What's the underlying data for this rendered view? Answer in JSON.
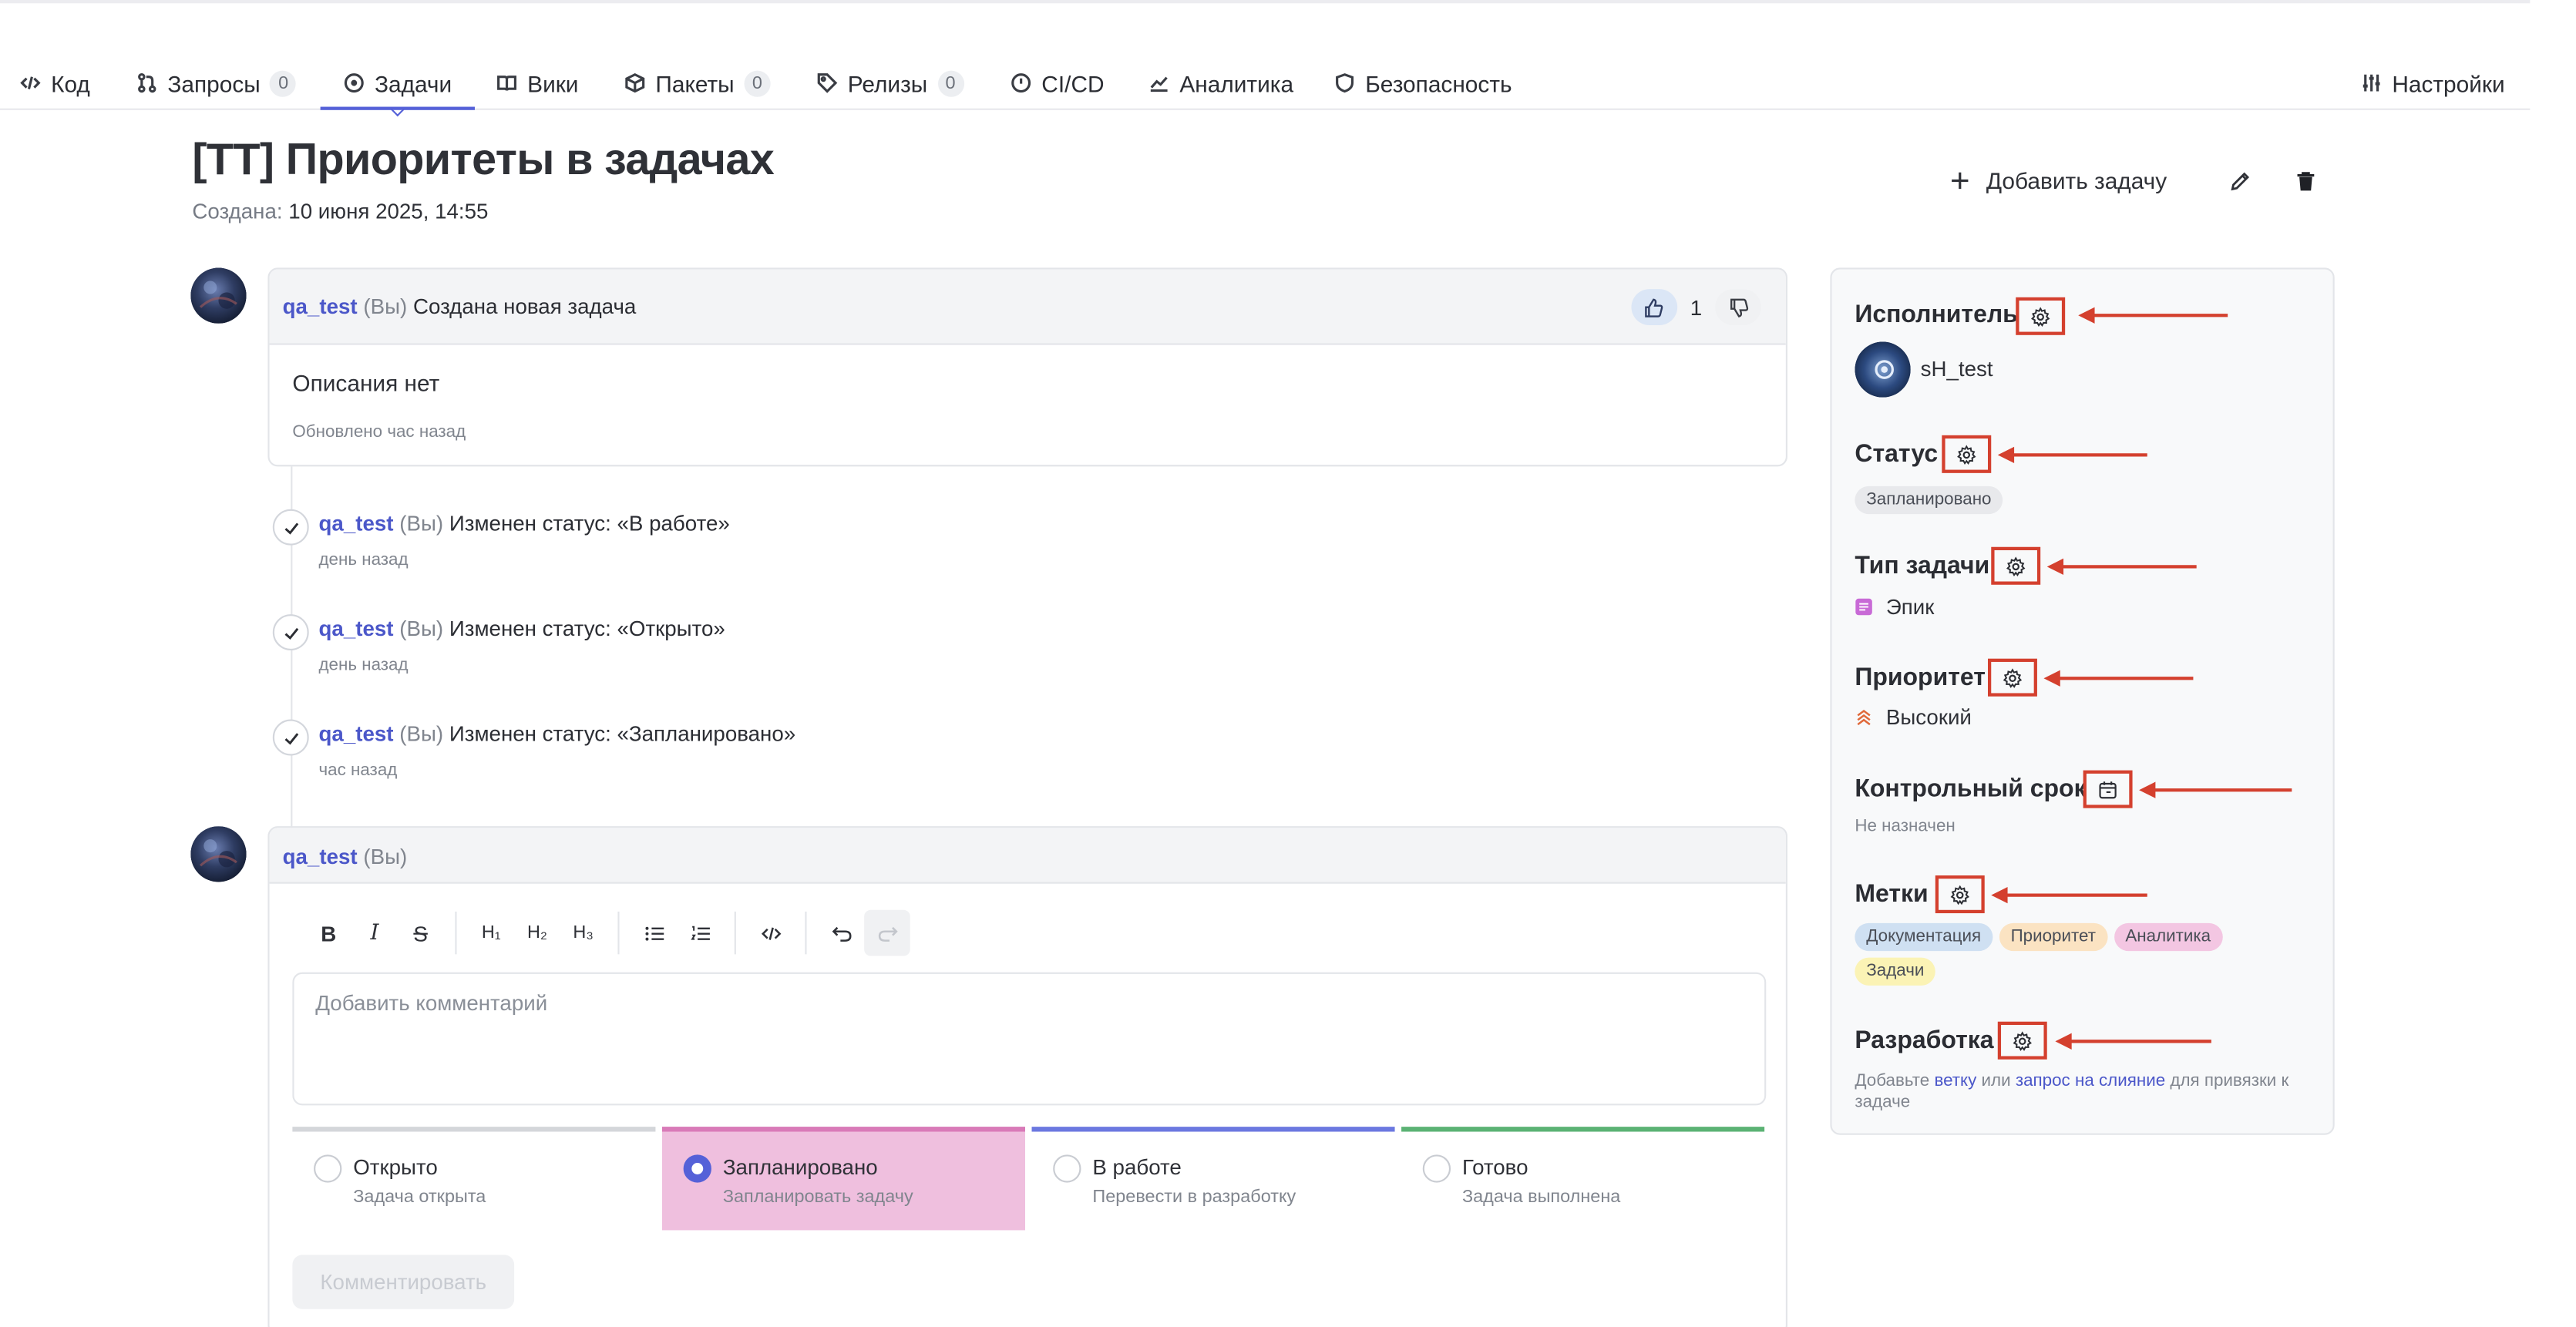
{
  "nav": {
    "tabs": [
      {
        "label": "Код",
        "icon": "code-icon"
      },
      {
        "label": "Запросы",
        "count": "0",
        "icon": "merge-request-icon"
      },
      {
        "label": "Задачи",
        "icon": "issue-icon",
        "active": true
      },
      {
        "label": "Вики",
        "icon": "book-icon"
      },
      {
        "label": "Пакеты",
        "count": "0",
        "icon": "package-icon"
      },
      {
        "label": "Релизы",
        "count": "0",
        "icon": "tag-icon"
      },
      {
        "label": "CI/CD",
        "icon": "pipeline-icon"
      },
      {
        "label": "Аналитика",
        "icon": "chart-icon"
      },
      {
        "label": "Безопасность",
        "icon": "shield-icon"
      }
    ],
    "settings": "Настройки"
  },
  "issue": {
    "title": "[TT] Приоритеты в задачах",
    "created_label": "Создана:",
    "created_value": "10 июня 2025, 14:55",
    "add_task": "Добавить задачу"
  },
  "description": {
    "user": "qa_test",
    "you": "(Вы)",
    "action": "Создана новая задача",
    "likes": "1",
    "text": "Описания нет",
    "updated": "Обновлено час назад"
  },
  "events": [
    {
      "user": "qa_test",
      "you": "(Вы)",
      "text": "Изменен статус: «В работе»",
      "time": "день назад"
    },
    {
      "user": "qa_test",
      "you": "(Вы)",
      "text": "Изменен статус: «Открыто»",
      "time": "день назад"
    },
    {
      "user": "qa_test",
      "you": "(Вы)",
      "text": "Изменен статус: «Запланировано»",
      "time": "час назад"
    }
  ],
  "editor": {
    "user": "qa_test",
    "you": "(Вы)",
    "placeholder": "Добавить комментарий",
    "submit": "Комментировать",
    "statuses": [
      {
        "name": "Открыто",
        "desc": "Задача открыта",
        "color": "#d4d6da",
        "selected": false
      },
      {
        "name": "Запланировано",
        "desc": "Запланировать задачу",
        "color": "#d97ab8",
        "selected": true
      },
      {
        "name": "В работе",
        "desc": "Перевести в разработку",
        "color": "#6b78e0",
        "selected": false
      },
      {
        "name": "Готово",
        "desc": "Задача выполнена",
        "color": "#5bb274",
        "selected": false
      }
    ]
  },
  "sidebar": {
    "assignee": {
      "title": "Исполнитель",
      "value": "sH_test"
    },
    "status": {
      "title": "Статус",
      "value": "Запланировано"
    },
    "type": {
      "title": "Тип задачи",
      "value": "Эпик"
    },
    "priority": {
      "title": "Приоритет",
      "value": "Высокий"
    },
    "deadline": {
      "title": "Контрольный срок",
      "value": "Не назначен"
    },
    "labels": {
      "title": "Метки",
      "items": [
        {
          "name": "Документация",
          "color": "#cfe0f2"
        },
        {
          "name": "Приоритет",
          "color": "#fbe3c2"
        },
        {
          "name": "Аналитика",
          "color": "#f3c6e2"
        },
        {
          "name": "Задачи",
          "color": "#fbf3b5"
        }
      ]
    },
    "dev": {
      "title": "Разработка",
      "text_1": "Добавьте",
      "link_1": "ветку",
      "text_2": "или",
      "link_2": "запрос на слияние",
      "text_3": "для привязки к задаче"
    }
  },
  "colors": {
    "accent": "#5561d8",
    "annotation": "#d4402e"
  }
}
